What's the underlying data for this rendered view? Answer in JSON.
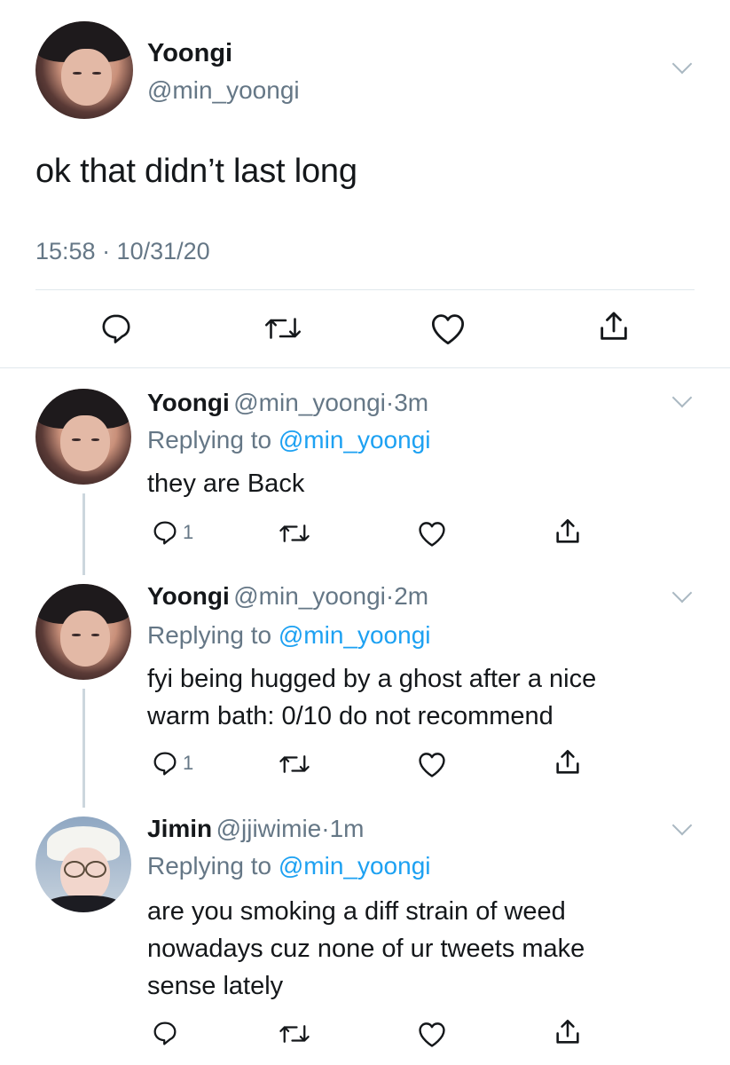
{
  "main_tweet": {
    "name": "Yoongi",
    "handle": "@min_yoongi",
    "text": "ok that didn’t last long",
    "timestamp": "15:58 · 10/31/20",
    "icons": [
      "reply-icon",
      "retweet-icon",
      "like-icon",
      "share-icon"
    ]
  },
  "replies": [
    {
      "name": "Yoongi",
      "handle": "@min_yoongi",
      "sep": "·",
      "time": "3m",
      "replying_prefix": "Replying to ",
      "replying_to": "@min_yoongi",
      "lines": [
        "they are Back"
      ],
      "reply_count": "1"
    },
    {
      "name": "Yoongi",
      "handle": "@min_yoongi",
      "sep": "·",
      "time": "2m",
      "replying_prefix": "Replying to ",
      "replying_to": "@min_yoongi",
      "lines": [
        "fyi being hugged by a ghost after a nice",
        "warm bath: 0/10 do not recommend"
      ],
      "reply_count": "1"
    },
    {
      "name": "Jimin",
      "handle": "@jjiwimie",
      "sep": "·",
      "time": "1m",
      "replying_prefix": "Replying to ",
      "replying_to": "@min_yoongi",
      "lines": [
        "are you smoking a diff strain of weed",
        "nowadays cuz none of ur tweets make",
        "sense lately"
      ],
      "reply_count": ""
    }
  ],
  "colors": {
    "text": "#14171a",
    "secondary": "#657786",
    "link": "#1da1f2",
    "divider": "#e1e8ed",
    "thread_line": "#ccd6dd"
  }
}
